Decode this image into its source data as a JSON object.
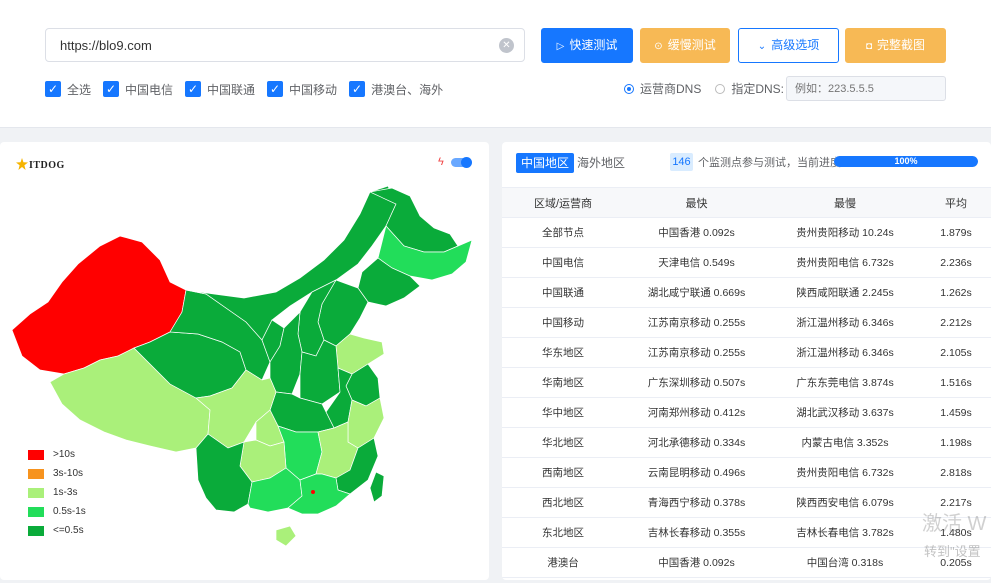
{
  "search": {
    "url_value": "https://blo9.com",
    "clear_icon": "close-circle-icon"
  },
  "buttons": {
    "fast": "快速测试",
    "slow": "缓慢测试",
    "advanced": "高级选项",
    "screenshot": "完整截图"
  },
  "isp_filters": [
    {
      "label": "全选",
      "checked": true
    },
    {
      "label": "中国电信",
      "checked": true
    },
    {
      "label": "中国联通",
      "checked": true
    },
    {
      "label": "中国移动",
      "checked": true
    },
    {
      "label": "港澳台、海外",
      "checked": true
    }
  ],
  "dns": {
    "option_isp": "运营商DNS",
    "option_custom": "指定DNS:",
    "selected": "运营商DNS",
    "custom_placeholder": "例如：223.5.5.5"
  },
  "map": {
    "logo_text": "ITDOG",
    "toggle_on": true,
    "legend": [
      {
        "label": ">10s",
        "color": "#ff0000"
      },
      {
        "label": "3s-10s",
        "color": "#f7931e"
      },
      {
        "label": "1s-3s",
        "color": "#aaf07a"
      },
      {
        "label": "0.5s-1s",
        "color": "#22dd5a"
      },
      {
        "label": "<=0.5s",
        "color": "#0aab3a"
      }
    ]
  },
  "results": {
    "tabs": [
      "中国地区",
      "海外地区"
    ],
    "active_tab": "中国地区",
    "node_count": "146",
    "progress_text": "个监测点参与测试，当前进度：",
    "progress_percent": 100,
    "progress_label": "100%",
    "columns": [
      "区域/运营商",
      "最快",
      "最慢",
      "平均"
    ],
    "rows": [
      [
        "全部节点",
        "中国香港 0.092s",
        "贵州贵阳移动 10.24s",
        "1.879s"
      ],
      [
        "中国电信",
        "天津电信 0.549s",
        "贵州贵阳电信 6.732s",
        "2.236s"
      ],
      [
        "中国联通",
        "湖北咸宁联通 0.669s",
        "陕西咸阳联通 2.245s",
        "1.262s"
      ],
      [
        "中国移动",
        "江苏南京移动 0.255s",
        "浙江温州移动 6.346s",
        "2.212s"
      ],
      [
        "华东地区",
        "江苏南京移动 0.255s",
        "浙江温州移动 6.346s",
        "2.105s"
      ],
      [
        "华南地区",
        "广东深圳移动 0.507s",
        "广东东莞电信 3.874s",
        "1.516s"
      ],
      [
        "华中地区",
        "河南郑州移动 0.412s",
        "湖北武汉移动 3.637s",
        "1.459s"
      ],
      [
        "华北地区",
        "河北承德移动 0.334s",
        "内蒙古电信 3.352s",
        "1.198s"
      ],
      [
        "西南地区",
        "云南昆明移动 0.496s",
        "贵州贵阳电信 6.732s",
        "2.818s"
      ],
      [
        "西北地区",
        "青海西宁移动 0.378s",
        "陕西西安电信 6.079s",
        "2.217s"
      ],
      [
        "东北地区",
        "吉林长春移动 0.355s",
        "吉林长春电信 3.782s",
        "1.480s"
      ],
      [
        "港澳台",
        "中国香港 0.092s",
        "中国台湾 0.318s",
        "0.205s"
      ]
    ]
  },
  "watermark": {
    "line1": "激活 W",
    "line2": "转到\"设置"
  }
}
